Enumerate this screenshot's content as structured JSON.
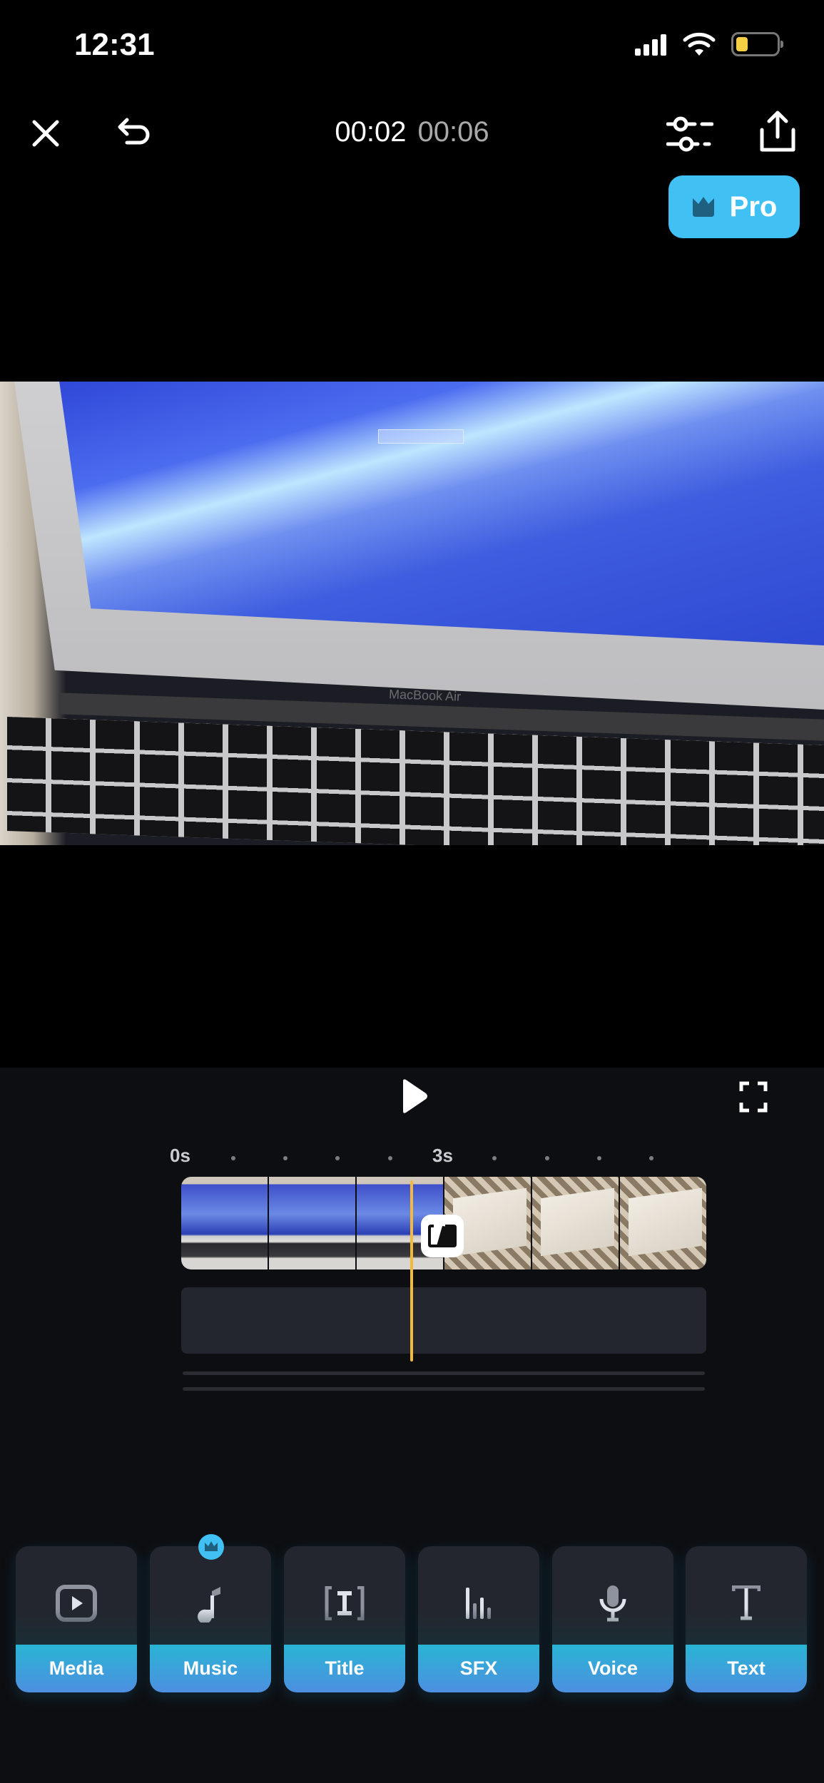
{
  "status_bar": {
    "time": "12:31",
    "battery_color": "#f6cf45"
  },
  "top_bar": {
    "current_time": "00:02",
    "total_time": "00:06",
    "icons": [
      "close-icon",
      "undo-icon",
      "adjust-icon",
      "share-icon"
    ]
  },
  "pro_button": {
    "label": "Pro",
    "color": "#41c0f4",
    "icon": "crown-icon"
  },
  "video": {
    "brand_text": "MacBook Air"
  },
  "timeline": {
    "ruler": {
      "labels": [
        "0s",
        "3s"
      ]
    },
    "playhead_color": "#f4b83a",
    "playhead_seconds": 2
  },
  "tools": [
    {
      "label": "Media",
      "icon": "media-play-icon"
    },
    {
      "label": "Music",
      "icon": "music-note-icon",
      "pro": true
    },
    {
      "label": "Title",
      "icon": "title-icon"
    },
    {
      "label": "SFX",
      "icon": "sfx-bars-icon"
    },
    {
      "label": "Voice",
      "icon": "microphone-icon"
    },
    {
      "label": "Text",
      "icon": "text-icon"
    }
  ]
}
